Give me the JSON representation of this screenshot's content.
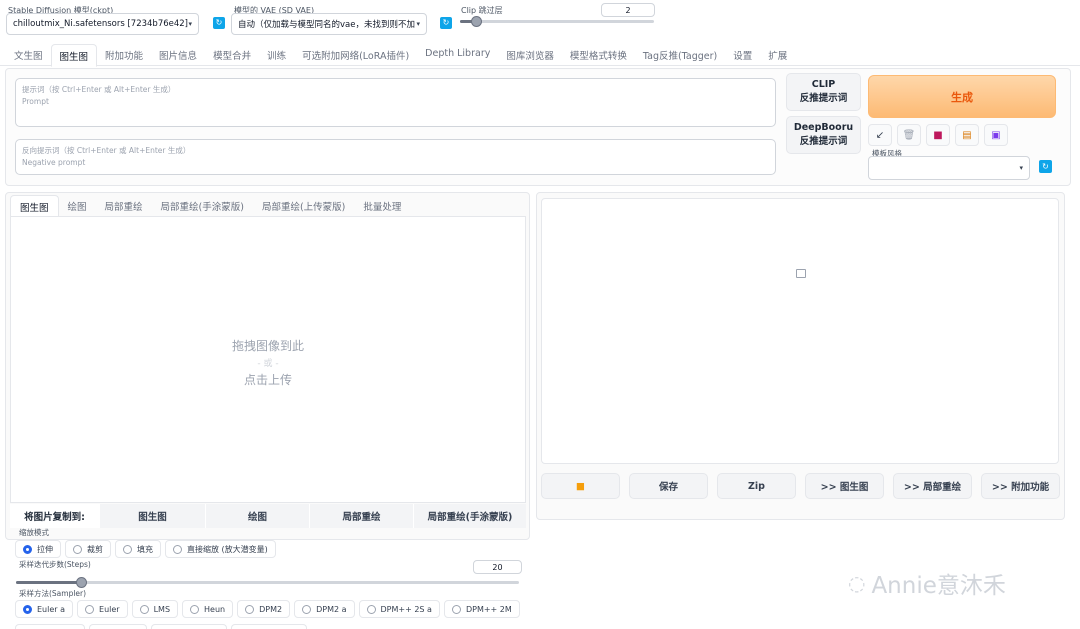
{
  "top": {
    "ckpt_label": "Stable Diffusion 模型(ckpt)",
    "ckpt_value": "chilloutmix_Ni.safetensors [7234b76e42]",
    "vae_label": "模型的 VAE (SD VAE)",
    "vae_value": "自动（仅加载与模型同名的vae，未找到则不加",
    "clip_label": "Clip 跳过层",
    "clip_value": "2",
    "clip_fraction": 0.08
  },
  "main_tabs": [
    "文生图",
    "图生图",
    "附加功能",
    "图片信息",
    "模型合并",
    "训练",
    "可选附加网络(LoRA插件)",
    "Depth Library",
    "图库浏览器",
    "模型格式转换",
    "Tag反推(Tagger)",
    "设置",
    "扩展"
  ],
  "main_tab_active": "图生图",
  "prompt": {
    "hint": "提示词（按 Ctrl+Enter 或 Alt+Enter 生成）",
    "placeholder": "Prompt"
  },
  "negative": {
    "hint": "反向提示词（按 Ctrl+Enter 或 Alt+Enter 生成）",
    "placeholder": "Negative prompt"
  },
  "interrogate": {
    "clip_line1": "CLIP",
    "clip_line2": "反推提示词",
    "deepbooru_line1": "DeepBooru",
    "deepbooru_line2": "反推提示词"
  },
  "generate_label": "生成",
  "tool_icons": [
    "arrow-icon",
    "trash-icon",
    "book-icon",
    "clipboard-icon",
    "save-icon"
  ],
  "style_label": "模板风格",
  "sub_tabs": [
    "图生图",
    "绘图",
    "局部重绘",
    "局部重绘(手涂蒙版)",
    "局部重绘(上传蒙版)",
    "批量处理"
  ],
  "sub_tab_active": "图生图",
  "drop": {
    "line1": "拖拽图像到此",
    "line2": "- 或 -",
    "line3": "点击上传"
  },
  "copy_to": {
    "head": "将图片复制到:",
    "targets": [
      "图生图",
      "绘图",
      "局部重绘",
      "局部重绘(手涂蒙版)"
    ]
  },
  "output_buttons": [
    "保存",
    "Zip",
    ">> 图生图",
    ">> 局部重绘",
    ">> 附加功能"
  ],
  "resize": {
    "label": "缩放模式",
    "options": [
      "拉伸",
      "裁剪",
      "填充",
      "直接缩放 (放大潜变量)"
    ],
    "selected": "拉伸"
  },
  "steps": {
    "label": "采样迭代步数(Steps)",
    "value": "20",
    "fraction": 0.13
  },
  "sampler": {
    "label": "采样方法(Sampler)",
    "options": [
      "Euler a",
      "Euler",
      "LMS",
      "Heun",
      "DPM2",
      "DPM2 a",
      "DPM++ 2S a",
      "DPM++ 2M"
    ],
    "selected": "Euler a"
  },
  "watermark": "Annie意沐禾",
  "colors": {
    "accent": "#0ea5e9",
    "generate_bg": "#fdba74",
    "generate_text": "#ea580c",
    "radio_selected": "#2563eb"
  }
}
